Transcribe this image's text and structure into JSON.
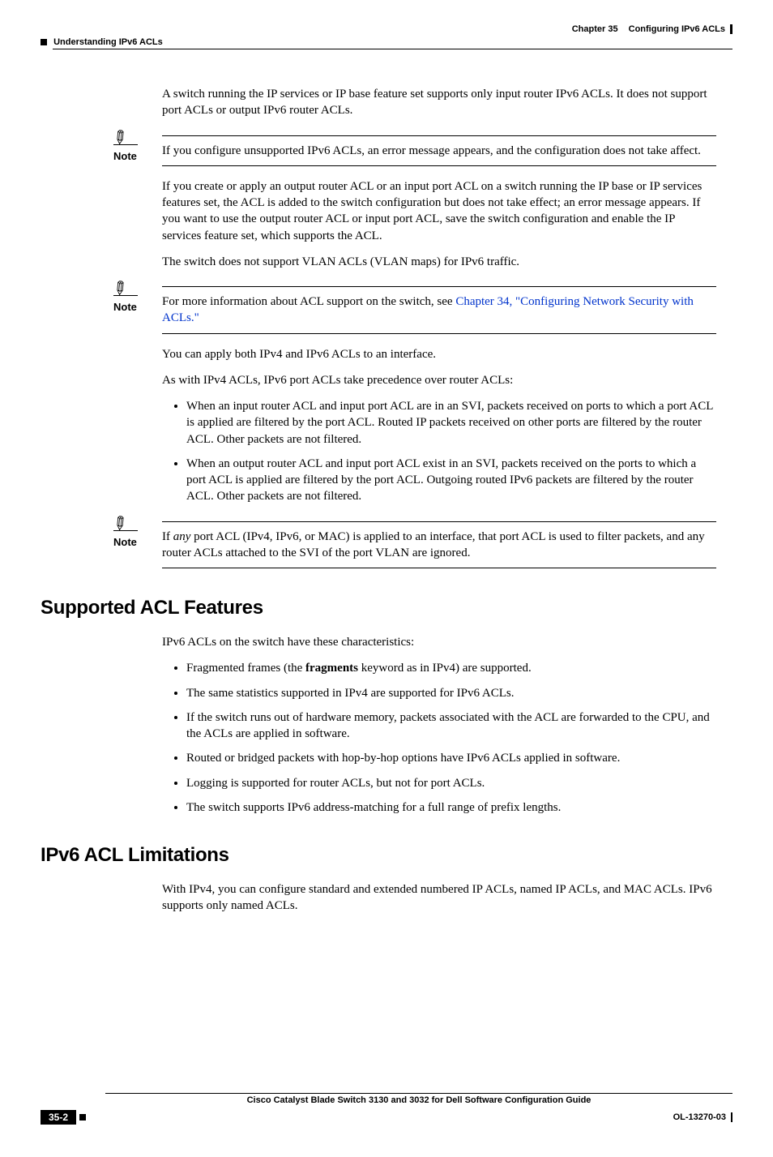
{
  "header": {
    "chapter_label": "Chapter 35",
    "chapter_title": "Configuring IPv6 ACLs",
    "section_left": "Understanding IPv6 ACLs"
  },
  "body": {
    "p1": "A switch running the IP services or IP base feature set supports only input router IPv6 ACLs. It does not support port ACLs or output IPv6 router ACLs.",
    "note1": {
      "label": "Note",
      "text": "If you configure unsupported IPv6 ACLs, an error message appears, and the configuration does not take affect."
    },
    "p2": "If you create or apply an output router ACL or an input port ACL on a switch running the IP base or IP services features set, the ACL is added to the switch configuration but does not take effect; an error message appears. If you want to use the output router ACL or input port ACL, save the switch configuration and enable the IP services feature set, which supports the ACL.",
    "p3": "The switch does not support VLAN ACLs (VLAN maps) for IPv6 traffic.",
    "note2": {
      "label": "Note",
      "text_prefix": "For more information about ACL support on the switch, see ",
      "link_text": "Chapter 34, \"Configuring Network Security with ACLs.\""
    },
    "p4": "You can apply both IPv4 and IPv6 ACLs to an interface.",
    "p5": "As with IPv4 ACLs, IPv6 port ACLs take precedence over router ACLs:",
    "bullets1": [
      "When an input router ACL and input port ACL are in an SVI, packets received on ports to which a port ACL is applied are filtered by the port ACL. Routed IP packets received on other ports are filtered by the router ACL. Other packets are not filtered.",
      "When an output router ACL and input port ACL exist in an SVI, packets received on the ports to which a port ACL is applied are filtered by the port ACL. Outgoing routed IPv6 packets are filtered by the router ACL. Other packets are not filtered."
    ],
    "note3": {
      "label": "Note",
      "pre": "If ",
      "italic": "any",
      "post": " port ACL (IPv4, IPv6, or MAC) is applied to an interface, that port ACL is used to filter packets, and any router ACLs attached to the SVI of the port VLAN are ignored."
    },
    "h2a": "Supported ACL Features",
    "p6": "IPv6 ACLs on the switch have these characteristics:",
    "bullets2_item1_pre": "Fragmented frames (the ",
    "bullets2_item1_bold": "fragments",
    "bullets2_item1_post": " keyword as in IPv4) are supported.",
    "bullets2_rest": [
      "The same statistics supported in IPv4 are supported for IPv6 ACLs.",
      "If the switch runs out of hardware memory, packets associated with the ACL are forwarded to the CPU, and the ACLs are applied in software.",
      "Routed or bridged packets with hop-by-hop options have IPv6 ACLs applied in software.",
      "Logging is supported for router ACLs, but not for port ACLs.",
      "The switch supports IPv6 address-matching for a full range of prefix lengths."
    ],
    "h2b": "IPv6 ACL Limitations",
    "p7": "With IPv4, you can configure standard and extended numbered IP ACLs, named IP ACLs, and MAC ACLs. IPv6 supports only named ACLs."
  },
  "footer": {
    "book_title": "Cisco Catalyst Blade Switch 3130 and 3032 for Dell Software Configuration Guide",
    "page_number": "35-2",
    "doc_id": "OL-13270-03"
  }
}
